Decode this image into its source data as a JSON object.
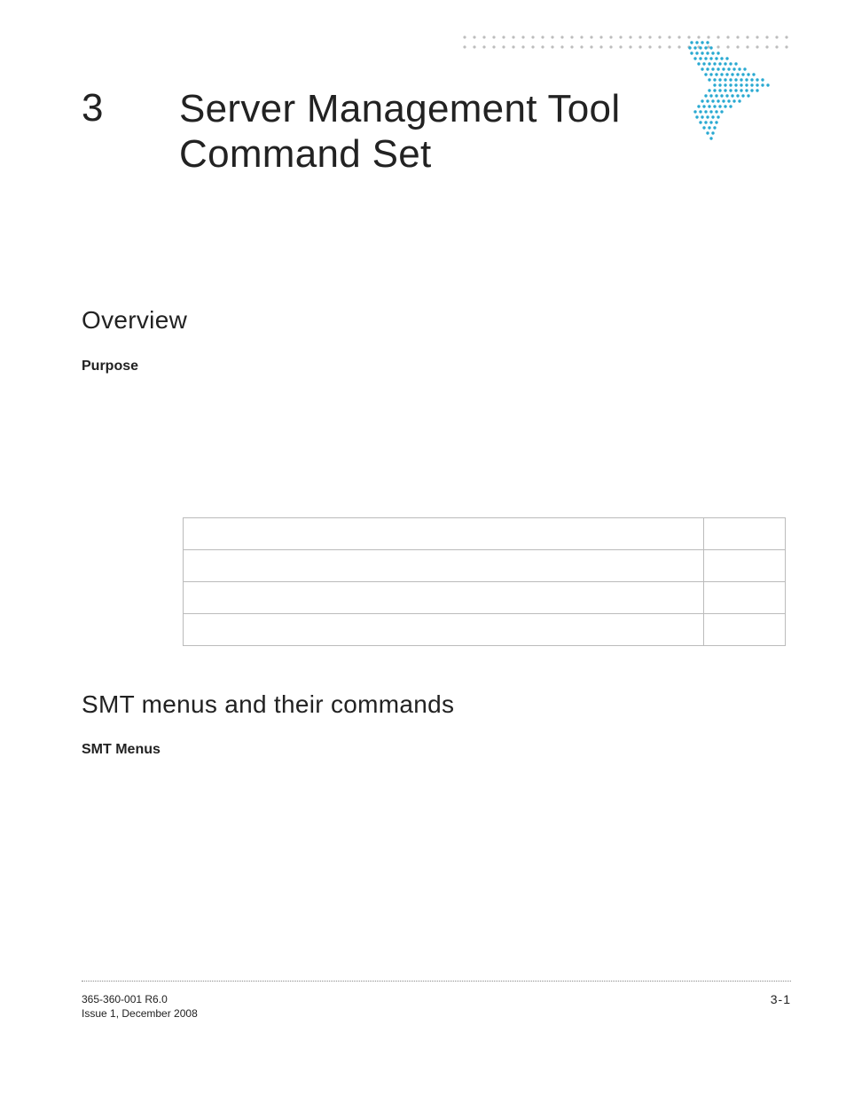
{
  "chapter": {
    "number": "3",
    "title": "Server Management Tool Command Set"
  },
  "sections": {
    "overview_heading": "Overview",
    "purpose_label": "Purpose",
    "smt_heading": "SMT menus and their commands",
    "smt_menus_label": "SMT Menus"
  },
  "toc": {
    "rows": [
      {
        "title": "",
        "page": ""
      },
      {
        "title": "",
        "page": ""
      },
      {
        "title": "",
        "page": ""
      },
      {
        "title": "",
        "page": ""
      }
    ]
  },
  "footer": {
    "doc_id": "365-360-001 R6.0",
    "issue": "Issue 1,   December 2008",
    "page_number": "3-1"
  },
  "decor": {
    "dot_color_light": "#bdbdbd",
    "dot_color_accent": "#29a9d1"
  }
}
